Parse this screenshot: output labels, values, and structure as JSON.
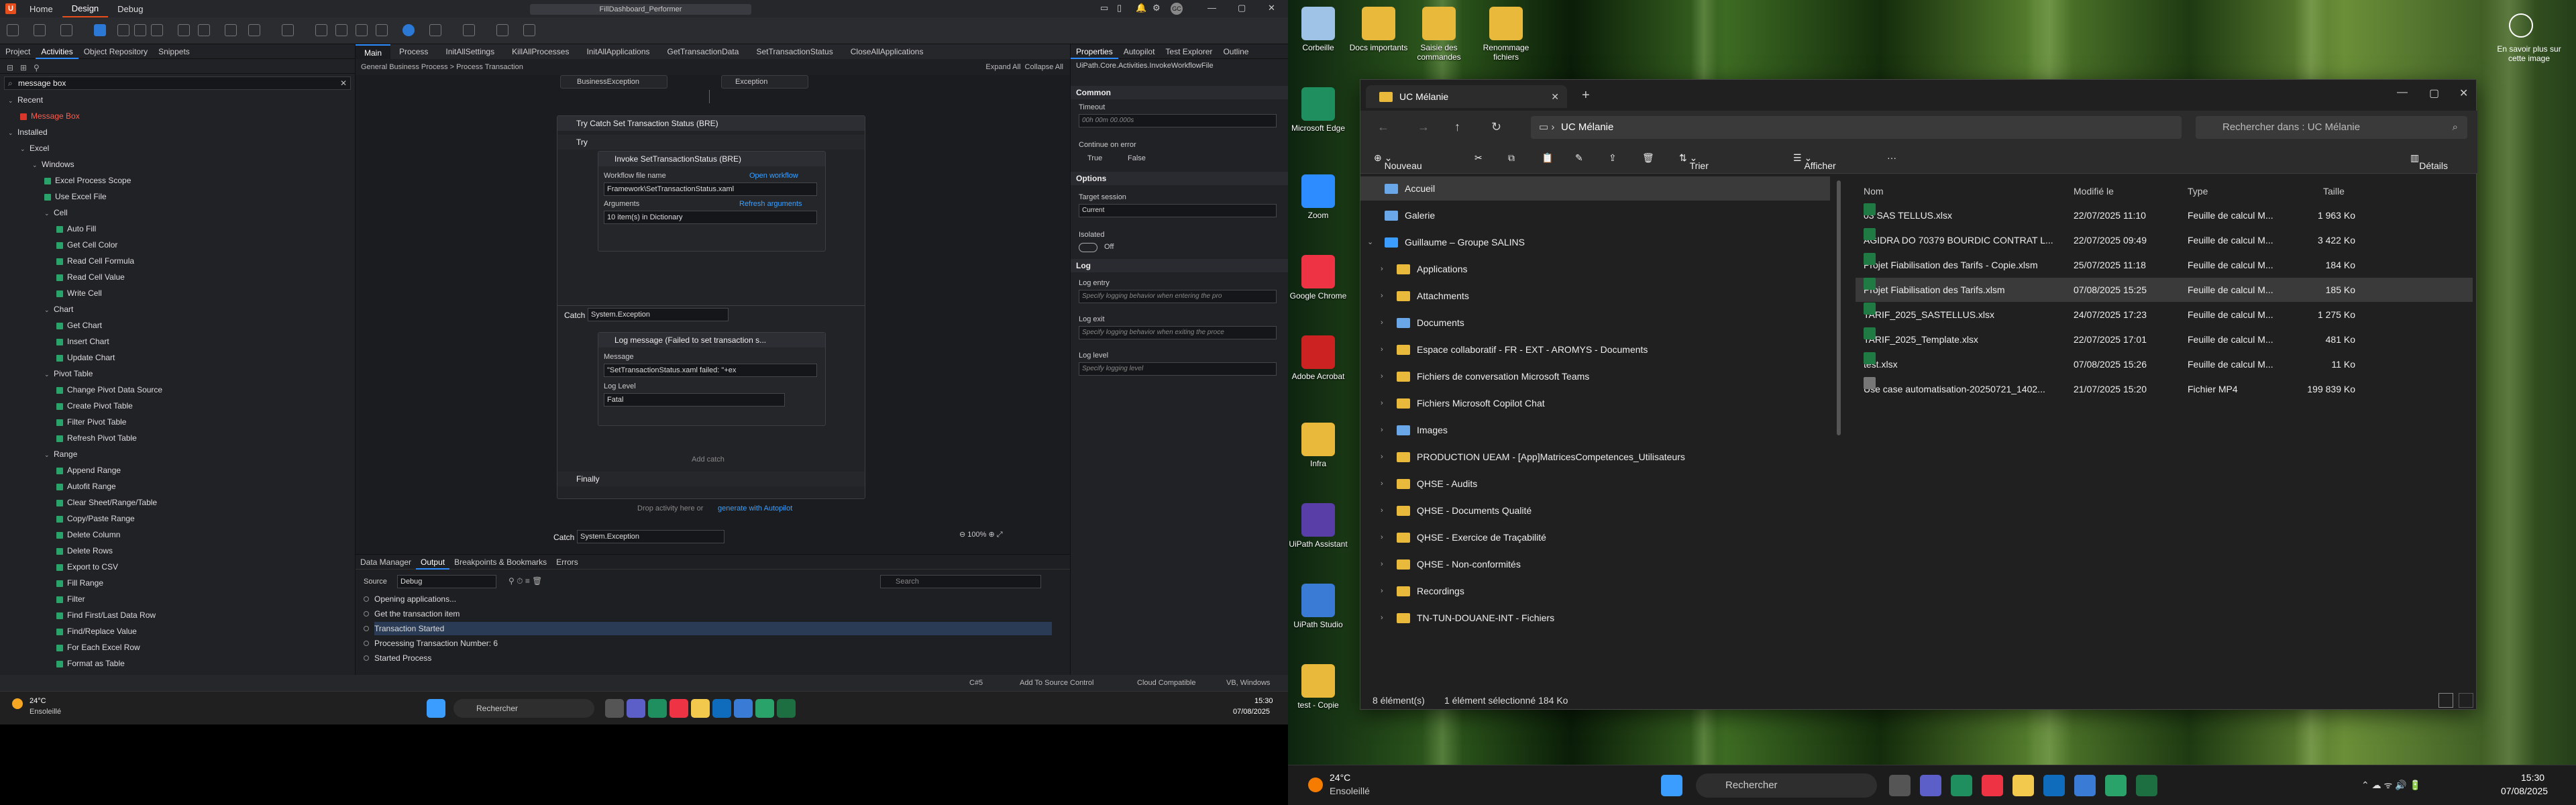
{
  "studio": {
    "menu": [
      "Home",
      "Design",
      "Debug"
    ],
    "title": "FillDashboard_Performer",
    "left_tabs": [
      "Project",
      "Activities",
      "Object Repository",
      "Snippets"
    ],
    "search_value": "message box",
    "tree": [
      {
        "label": "Recent",
        "level": 0,
        "type": "group"
      },
      {
        "label": "Message Box",
        "level": 1,
        "type": "highlight"
      },
      {
        "label": "Installed",
        "level": 0,
        "type": "group"
      },
      {
        "label": "Excel",
        "level": 1,
        "type": "group"
      },
      {
        "label": "Windows",
        "level": 2,
        "type": "group"
      },
      {
        "label": "Excel Process Scope",
        "level": 3,
        "type": "act"
      },
      {
        "label": "Use Excel File",
        "level": 3,
        "type": "act"
      },
      {
        "label": "Cell",
        "level": 3,
        "type": "group"
      },
      {
        "label": "Auto Fill",
        "level": 4,
        "type": "act"
      },
      {
        "label": "Get Cell Color",
        "level": 4,
        "type": "act"
      },
      {
        "label": "Read Cell Formula",
        "level": 4,
        "type": "act"
      },
      {
        "label": "Read Cell Value",
        "level": 4,
        "type": "act"
      },
      {
        "label": "Write Cell",
        "level": 4,
        "type": "act"
      },
      {
        "label": "Chart",
        "level": 3,
        "type": "group"
      },
      {
        "label": "Get Chart",
        "level": 4,
        "type": "act"
      },
      {
        "label": "Insert Chart",
        "level": 4,
        "type": "act"
      },
      {
        "label": "Update Chart",
        "level": 4,
        "type": "act"
      },
      {
        "label": "Pivot Table",
        "level": 3,
        "type": "group"
      },
      {
        "label": "Change Pivot Data Source",
        "level": 4,
        "type": "act"
      },
      {
        "label": "Create Pivot Table",
        "level": 4,
        "type": "act"
      },
      {
        "label": "Filter Pivot Table",
        "level": 4,
        "type": "act"
      },
      {
        "label": "Refresh Pivot Table",
        "level": 4,
        "type": "act"
      },
      {
        "label": "Range",
        "level": 3,
        "type": "group"
      },
      {
        "label": "Append Range",
        "level": 4,
        "type": "act"
      },
      {
        "label": "Autofit Range",
        "level": 4,
        "type": "act"
      },
      {
        "label": "Clear Sheet/Range/Table",
        "level": 4,
        "type": "act"
      },
      {
        "label": "Copy/Paste Range",
        "level": 4,
        "type": "act"
      },
      {
        "label": "Delete Column",
        "level": 4,
        "type": "act"
      },
      {
        "label": "Delete Rows",
        "level": 4,
        "type": "act"
      },
      {
        "label": "Export to CSV",
        "level": 4,
        "type": "act"
      },
      {
        "label": "Fill Range",
        "level": 4,
        "type": "act"
      },
      {
        "label": "Filter",
        "level": 4,
        "type": "act"
      },
      {
        "label": "Find First/Last Data Row",
        "level": 4,
        "type": "act"
      },
      {
        "label": "Find/Replace Value",
        "level": 4,
        "type": "act"
      },
      {
        "label": "For Each Excel Row",
        "level": 4,
        "type": "act"
      },
      {
        "label": "Format as Table",
        "level": 4,
        "type": "act"
      }
    ],
    "doc_tabs": [
      "Main",
      "Process",
      "InitAllSettings",
      "KillAllProcesses",
      "InitAllApplications",
      "GetTransactionData",
      "SetTransactionStatus",
      "CloseAllApplications"
    ],
    "breadcrumb": "General Business Process  >  Process Transaction",
    "expand_all": "Expand All",
    "collapse_all": "Collapse All",
    "designer": {
      "business_exception": "BusinessException",
      "exception": "Exception",
      "try_catch_title": "Try Catch Set Transaction Status (BRE)",
      "try": "Try",
      "invoke_title": "Invoke SetTransactionStatus (BRE)",
      "workflow_label": "Workflow file name",
      "open_workflow": "Open workflow",
      "workflow_value": "Framework\\SetTransactionStatus.xaml",
      "arguments_label": "Arguments",
      "refresh_arguments": "Refresh arguments",
      "arguments_value": "10 item(s) in Dictionary",
      "catch": "Catch",
      "catch_type": "System.Exception",
      "log_title": "Log message (Failed to set transaction s...",
      "message_label": "Message",
      "message_value": "\"SetTransactionStatus.xaml failed: \"+ex",
      "log_level_label": "Log Level",
      "log_level_value": "Fatal",
      "add_catch": "Add catch",
      "finally": "Finally",
      "drop_hint": "Drop activity here or",
      "generate": "generate with Autopilot",
      "catch2": "Catch",
      "catch2_type": "System.Exception",
      "zoom": "100%"
    },
    "output_tabs": [
      "Data Manager",
      "Output",
      "Breakpoints & Bookmarks",
      "Errors"
    ],
    "source_label": "Source",
    "source_value": "Debug",
    "search_placeholder": "Search",
    "output_lines": [
      "Opening applications...",
      "Get the transaction item",
      "Transaction Started",
      "Processing Transaction Number: 6",
      "Started Process"
    ],
    "prop_tabs": [
      "Properties",
      "Autopilot",
      "Test Explorer",
      "Outline"
    ],
    "prop_path": "UiPath.Core.Activities.InvokeWorkflowFile",
    "sections": {
      "common": "Common",
      "options": "Options",
      "log": "Log"
    },
    "timeout_label": "Timeout",
    "timeout_placeholder": "00h 00m 00.000s",
    "continue_label": "Continue on error",
    "true": "True",
    "false": "False",
    "target_label": "Target session",
    "target_value": "Current",
    "isolated_label": "Isolated",
    "off": "Off",
    "log_entry": "Log entry",
    "log_entry_ph": "Specify logging behavior when entering the pro",
    "log_exit": "Log exit",
    "log_exit_ph": "Specify logging behavior when exiting the proce",
    "log_level": "Log level",
    "log_level_ph": "Specify logging level",
    "status_items": [
      "C#5",
      "Add To Source Control",
      "Cloud Compatible",
      "VB, Windows"
    ],
    "weather": {
      "temp": "24°C",
      "desc": "Ensoleillé"
    },
    "taskbar_search": "Rechercher",
    "clock": {
      "time": "15:30",
      "date": "07/08/2025"
    }
  },
  "desktop": {
    "icons": [
      {
        "label": "Corbeille"
      },
      {
        "label": "Docs importants"
      },
      {
        "label": "Saisie des commandes"
      },
      {
        "label": "Renommage fichiers"
      },
      {
        "label": "Microsoft Edge"
      },
      {
        "label": "Zoom"
      },
      {
        "label": "Google Chrome"
      },
      {
        "label": "Adobe Acrobat"
      },
      {
        "label": "Infra"
      },
      {
        "label": "UiPath Assistant"
      },
      {
        "label": "UiPath Studio"
      },
      {
        "label": "test - Copie"
      }
    ],
    "know_more": "En savoir plus sur cette image"
  },
  "explorer": {
    "tab_title": "UC Mélanie",
    "address": "UC Mélanie",
    "search_placeholder": "Rechercher dans : UC Mélanie",
    "cmd": {
      "new": "Nouveau",
      "sort": "Trier",
      "view": "Afficher",
      "details": "Détails"
    },
    "nav": [
      {
        "label": "Accueil",
        "type": "home"
      },
      {
        "label": "Galerie",
        "type": "gallery"
      },
      {
        "label": "Guillaume – Groupe SALINS",
        "type": "cloud"
      },
      {
        "label": "Applications",
        "type": "folder"
      },
      {
        "label": "Attachments",
        "type": "folder"
      },
      {
        "label": "Documents",
        "type": "doc"
      },
      {
        "label": "Espace collaboratif - FR - EXT - AROMYS - Documents",
        "type": "folder"
      },
      {
        "label": "Fichiers de conversation Microsoft Teams",
        "type": "folder"
      },
      {
        "label": "Fichiers Microsoft Copilot Chat",
        "type": "folder"
      },
      {
        "label": "Images",
        "type": "img"
      },
      {
        "label": "PRODUCTION UEAM - [App]MatricesCompetences_Utilisateurs",
        "type": "folder"
      },
      {
        "label": "QHSE - Audits",
        "type": "folder"
      },
      {
        "label": "QHSE - Documents Qualité",
        "type": "folder"
      },
      {
        "label": "QHSE - Exercice de Traçabilité",
        "type": "folder"
      },
      {
        "label": "QHSE - Non-conformités",
        "type": "folder"
      },
      {
        "label": "Recordings",
        "type": "folder"
      },
      {
        "label": "TN-TUN-DOUANE-INT - Fichiers",
        "type": "folder"
      }
    ],
    "columns": [
      "Nom",
      "Modifié le",
      "Type",
      "Taille"
    ],
    "files": [
      {
        "name": "03 SAS TELLUS.xlsx",
        "date": "22/07/2025 11:10",
        "type": "Feuille de calcul M...",
        "size": "1 963 Ko",
        "kind": "xl"
      },
      {
        "name": "AGIDRA DO 70379 BOURDIC CONTRAT L...",
        "date": "22/07/2025 09:49",
        "type": "Feuille de calcul M...",
        "size": "3 422 Ko",
        "kind": "xl"
      },
      {
        "name": "Projet Fiabilisation des Tarifs - Copie.xlsm",
        "date": "25/07/2025 11:18",
        "type": "Feuille de calcul M...",
        "size": "184 Ko",
        "kind": "xl"
      },
      {
        "name": "Projet Fiabilisation des Tarifs.xlsm",
        "date": "07/08/2025 15:25",
        "type": "Feuille de calcul M...",
        "size": "185 Ko",
        "kind": "xl",
        "selected": true
      },
      {
        "name": "TARIF_2025_SASTELLUS.xlsx",
        "date": "24/07/2025 17:23",
        "type": "Feuille de calcul M...",
        "size": "1 275 Ko",
        "kind": "xl"
      },
      {
        "name": "TARIF_2025_Template.xlsx",
        "date": "22/07/2025 17:01",
        "type": "Feuille de calcul M...",
        "size": "481 Ko",
        "kind": "xl"
      },
      {
        "name": "test.xlsx",
        "date": "07/08/2025 15:26",
        "type": "Feuille de calcul M...",
        "size": "11 Ko",
        "kind": "xl"
      },
      {
        "name": "Use case automatisation-20250721_1402...",
        "date": "21/07/2025 15:20",
        "type": "Fichier MP4",
        "size": "199 839 Ko",
        "kind": "mp4"
      }
    ],
    "status_count": "8 élément(s)",
    "status_sel": "1 élément sélectionné  184 Ko"
  },
  "taskbar2": {
    "weather_temp": "24°C",
    "weather_desc": "Ensoleillé",
    "search": "Rechercher",
    "time": "15:30",
    "date": "07/08/2025"
  }
}
